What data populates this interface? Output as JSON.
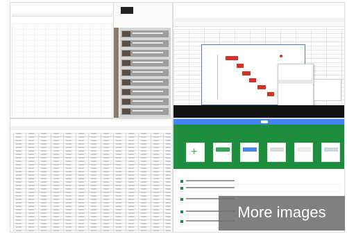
{
  "tiles": [
    {
      "kind": "document-with-side-panel"
    },
    {
      "kind": "spreadsheet-gantt-chart"
    },
    {
      "kind": "spreadsheet-table"
    },
    {
      "kind": "sheets-template-gallery"
    }
  ],
  "colors": {
    "gantt_red": "#d93025",
    "sheets_green": "#1e8e3e",
    "google_blue": "#4285f4",
    "overlay_gray": "#6e6e6e"
  },
  "more_images": {
    "label": "More images"
  }
}
